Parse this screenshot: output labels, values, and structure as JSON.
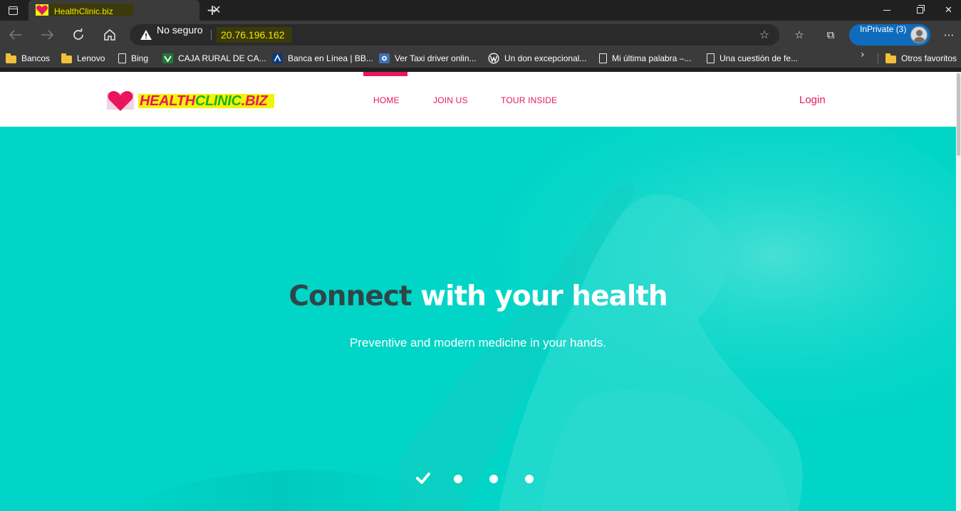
{
  "browser": {
    "tab": {
      "title": "HealthClinic.biz",
      "close_glyph": "✕"
    },
    "new_tab_glyph": "+",
    "window_controls": {
      "close_glyph": "✕"
    },
    "address": {
      "security_label": "No seguro",
      "url": "20.76.196.162"
    },
    "inprivate_label": "InPrivate (3)",
    "more_glyph": "⋯",
    "bookmarks": [
      {
        "label": "Bancos",
        "icon": "folder-icon"
      },
      {
        "label": "Lenovo",
        "icon": "folder-icon"
      },
      {
        "label": "Bing",
        "icon": "page-icon"
      },
      {
        "label": "CAJA RURAL DE CA...",
        "icon": "caja-rural-icon"
      },
      {
        "label": "Banca en Línea | BB...",
        "icon": "bbva-icon"
      },
      {
        "label": "Ver Taxi driver onlin...",
        "icon": "video-site-icon"
      },
      {
        "label": "Un don excepcional...",
        "icon": "wordpress-icon"
      },
      {
        "label": "Mi última palabra –...",
        "icon": "page-icon"
      },
      {
        "label": "Una cuestión de fe...",
        "icon": "page-icon"
      }
    ],
    "other_favorites": "Otros favoritos"
  },
  "site": {
    "logo": {
      "part1": "HEALTH",
      "part2": "CLINIC",
      "part3": ".BIZ"
    },
    "nav": [
      {
        "label": "HOME",
        "active": true
      },
      {
        "label": "JOIN US",
        "active": false
      },
      {
        "label": "TOUR INSIDE",
        "active": false
      }
    ],
    "login_label": "Login",
    "hero": {
      "title_dark": "Connect",
      "title_light": " with your health",
      "subtitle": "Preventive and modern medicine in your hands.",
      "slides": 4,
      "active_slide": 1
    }
  },
  "colors": {
    "accent": "#e8175d",
    "hero_bg": "#00d5c7",
    "logo_highlight": "#f2f20a",
    "inprivate": "#0f6cbd"
  }
}
